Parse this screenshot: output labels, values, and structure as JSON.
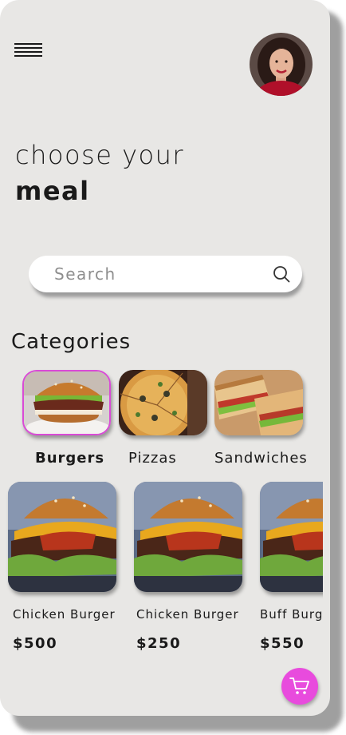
{
  "header": {
    "menu_icon": "hamburger-menu-icon",
    "avatar_alt": "user avatar"
  },
  "hero": {
    "line1": "choose your",
    "line2": "meal"
  },
  "search": {
    "placeholder": "Search",
    "value": "",
    "icon": "search-icon"
  },
  "categories": {
    "title": "Categories",
    "items": [
      {
        "label": "Burgers",
        "selected": true
      },
      {
        "label": "Pizzas",
        "selected": false
      },
      {
        "label": "Sandwiches",
        "selected": false
      }
    ]
  },
  "products": [
    {
      "name": "Chicken Burger",
      "price": "$500"
    },
    {
      "name": "Chicken Burger",
      "price": "$250"
    },
    {
      "name": "Buff Burger",
      "price": "$550"
    }
  ],
  "cart": {
    "icon": "cart-icon"
  },
  "colors": {
    "accent": "#e84bdd",
    "background": "#e8e7e5",
    "selected_border": "#d94bd6"
  }
}
